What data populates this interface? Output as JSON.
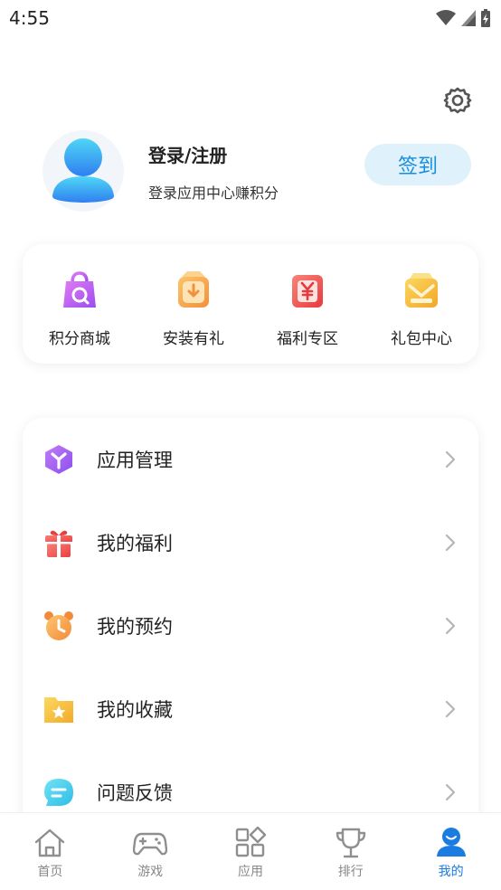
{
  "status_bar": {
    "time": "4:55"
  },
  "profile": {
    "title": "登录/注册",
    "subtitle": "登录应用中心赚积分",
    "signin_label": "签到"
  },
  "quick_actions": [
    {
      "label": "积分商城",
      "icon": "shopping-bag-icon",
      "color": "#b45ef0"
    },
    {
      "label": "安装有礼",
      "icon": "install-box-icon",
      "color": "#f5a547"
    },
    {
      "label": "福利专区",
      "icon": "red-envelope-icon",
      "color": "#f0524f"
    },
    {
      "label": "礼包中心",
      "icon": "gift-package-icon",
      "color": "#f6c23c"
    }
  ],
  "menu": [
    {
      "label": "应用管理",
      "icon": "app-cube-icon",
      "color": "#a35bf0"
    },
    {
      "label": "我的福利",
      "icon": "gift-icon",
      "color": "#f0524f"
    },
    {
      "label": "我的预约",
      "icon": "alarm-clock-icon",
      "color": "#f5a547"
    },
    {
      "label": "我的收藏",
      "icon": "star-folder-icon",
      "color": "#f6c23c"
    },
    {
      "label": "问题反馈",
      "icon": "chat-bubble-icon",
      "color": "#3fd0ec"
    }
  ],
  "tabbar": [
    {
      "label": "首页",
      "icon": "home-icon"
    },
    {
      "label": "游戏",
      "icon": "gamepad-icon"
    },
    {
      "label": "应用",
      "icon": "apps-grid-icon"
    },
    {
      "label": "排行",
      "icon": "trophy-icon"
    },
    {
      "label": "我的",
      "icon": "user-icon",
      "active": true
    }
  ],
  "colors": {
    "accent": "#1a7be0",
    "signin_bg": "#dff1fb",
    "signin_text": "#1a8ed8"
  }
}
